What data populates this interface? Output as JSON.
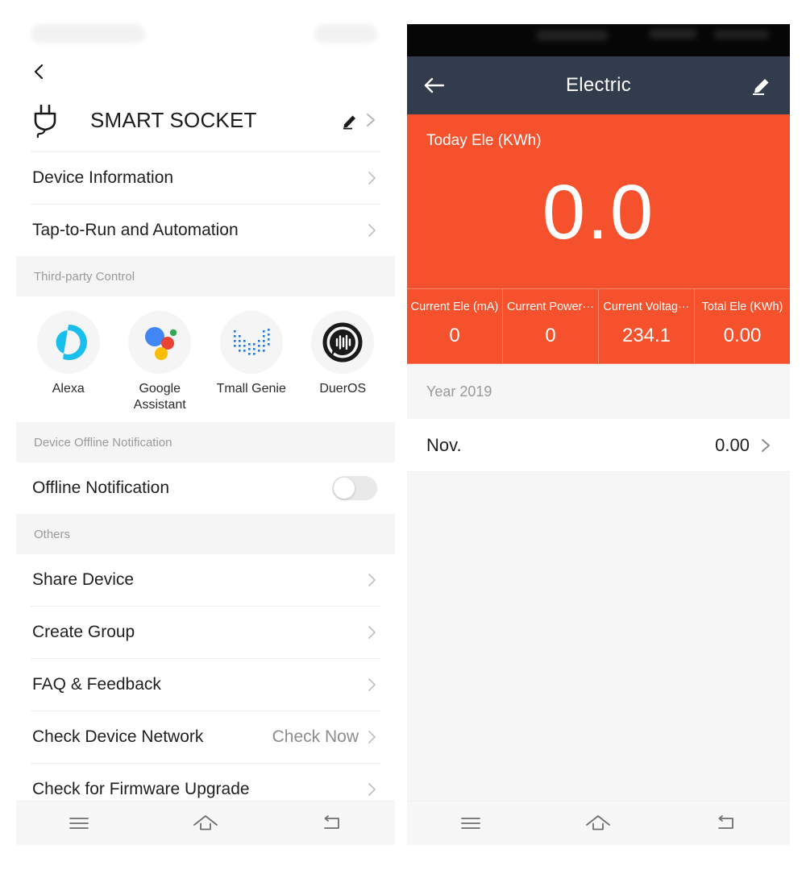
{
  "left_panel": {
    "back_icon": "chevron-left-icon",
    "device": {
      "icon": "power-plug-icon",
      "title": "SMART SOCKET",
      "edit_icon": "pencil-edit-icon",
      "chevron": "chevron-right-icon"
    },
    "menu_top": [
      {
        "label": "Device Information"
      },
      {
        "label": "Tap-to-Run and Automation"
      }
    ],
    "third_party": {
      "section_title": "Third-party Control",
      "items": [
        {
          "label": "Alexa",
          "icon": "alexa-icon",
          "color": "#19BFEC"
        },
        {
          "label": "Google Assistant",
          "icon": "google-assistant-icon",
          "colors": [
            "#4285F4",
            "#EA4335",
            "#FBBC05",
            "#34A853"
          ]
        },
        {
          "label": "Tmall Genie",
          "icon": "tmall-genie-icon",
          "color": "#2878D0"
        },
        {
          "label": "DuerOS",
          "icon": "dueros-icon",
          "color": "#1A1A1A"
        }
      ]
    },
    "offline": {
      "section_title": "Device Offline Notification",
      "row_label": "Offline Notification",
      "toggle_state": "off"
    },
    "others": {
      "section_title": "Others",
      "items": [
        {
          "label": "Share Device",
          "value": ""
        },
        {
          "label": "Create Group",
          "value": ""
        },
        {
          "label": "FAQ & Feedback",
          "value": ""
        },
        {
          "label": "Check Device Network",
          "value": "Check Now"
        },
        {
          "label": "Check for Firmware Upgrade",
          "value": ""
        }
      ]
    },
    "navbar": [
      {
        "icon": "menu-recents-icon"
      },
      {
        "icon": "home-icon"
      },
      {
        "icon": "back-arrow-icon"
      }
    ]
  },
  "right_panel": {
    "appbar": {
      "back_icon": "arrow-left-icon",
      "title": "Electric",
      "edit_icon": "pencil-edit-icon"
    },
    "summary": {
      "caption": "Today Ele (KWh)",
      "value": "0.0",
      "bg_color": "#F4512C"
    },
    "stats": [
      {
        "label": "Current Ele (mA)",
        "value": "0"
      },
      {
        "label": "Current Power···",
        "value": "0"
      },
      {
        "label": "Current Voltag···",
        "value": "234.1"
      },
      {
        "label": "Total Ele (KWh)",
        "value": "0.00"
      }
    ],
    "year_section": {
      "title": "Year 2019",
      "months": [
        {
          "name": "Nov.",
          "value": "0.00"
        }
      ]
    },
    "navbar": [
      {
        "icon": "menu-recents-icon"
      },
      {
        "icon": "home-icon"
      },
      {
        "icon": "back-arrow-icon"
      }
    ]
  }
}
